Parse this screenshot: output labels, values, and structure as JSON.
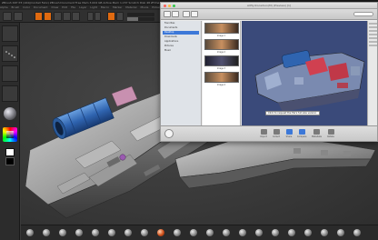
{
  "zbrush": {
    "title_text": "ZBrush  4R7 P3 (x64)(Cordell  Felix) ZBrush Document  Free Mem 3.004 GB  Active Mem 1,157  Scratch Disk 48  ZTime 1.447  Timer 0.022  PolyCount 4.254 MP  MeshCount 17",
    "menus": [
      "Alpha",
      "Brush",
      "Color",
      "Document",
      "Draw",
      "Edit",
      "File",
      "Layer",
      "Light",
      "Macro",
      "Marker",
      "Material",
      "Movie",
      "Picker",
      "Preferences",
      "Render",
      "Stencil",
      "Stroke",
      "Texture",
      "Tool",
      "Transform",
      "Zplugin",
      "Zscript"
    ],
    "accent_color": "#e06a10"
  },
  "mac_window": {
    "title": "AllHydrocarbon(M) (Preview) [1]",
    "sidebar_items": [
      "Favorites",
      "Documents",
      "Desktop",
      "Downloads",
      "Applications",
      "Pictures",
      "Music"
    ],
    "list_items": [
      "Image 1",
      "Image 2",
      "Image 3",
      "Image 4"
    ],
    "tooltip": "Click to request the file's full size version",
    "bottom_buttons": [
      "Import",
      "Collect",
      "Share",
      "Compare",
      "Metadata",
      "Rotate"
    ],
    "accent_color": "#3c78d8"
  }
}
